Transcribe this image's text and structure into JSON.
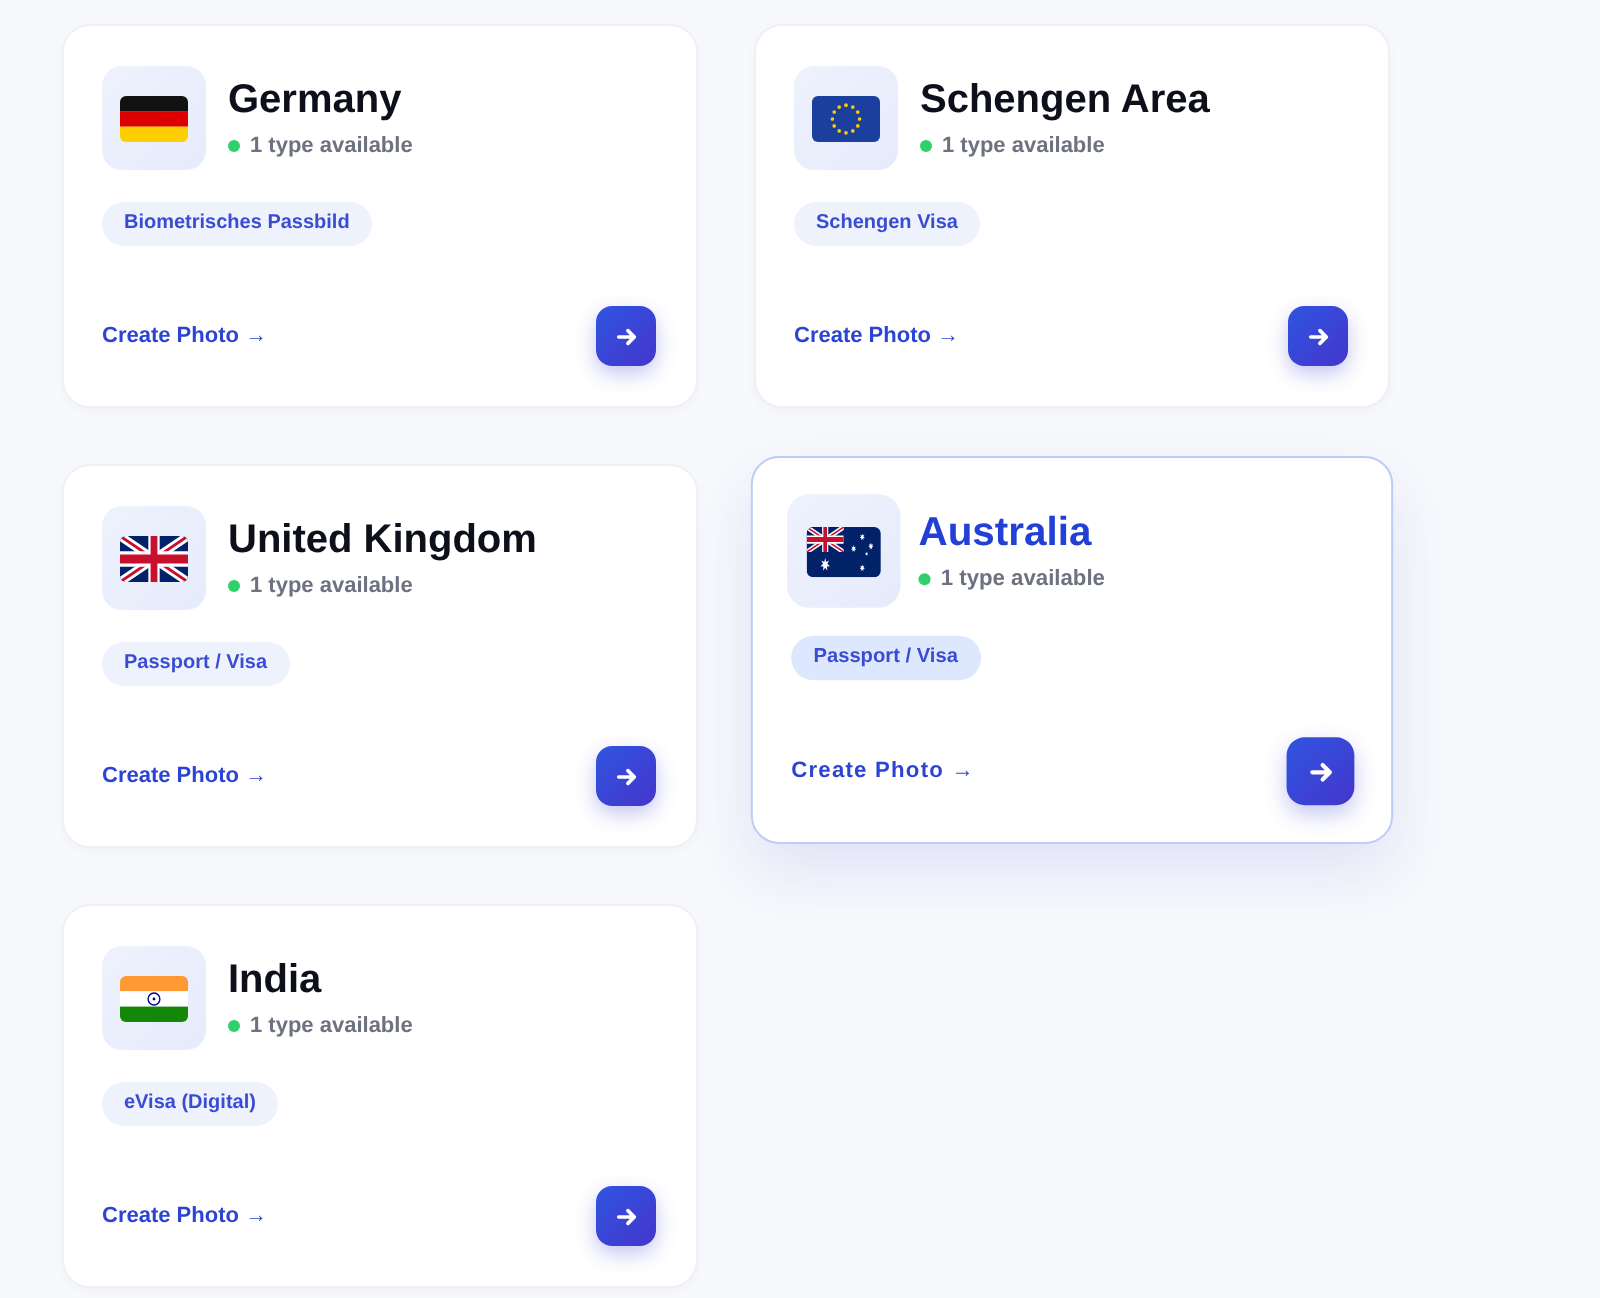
{
  "cards": [
    {
      "title": "Germany",
      "flag": {
        "kind": "germany"
      },
      "availability": "1 type available",
      "tags": [
        "Biometrisches Passbild"
      ],
      "link": "Create Photo →",
      "hovered": false
    },
    {
      "title": "Schengen Area",
      "flag": {
        "kind": "eu"
      },
      "availability": "1 type available",
      "tags": [
        "Schengen Visa"
      ],
      "link": "Create Photo →",
      "hovered": false
    },
    {
      "title": "United Kingdom",
      "flag": {
        "kind": "uk"
      },
      "availability": "1 type available",
      "tags": [
        "Passport / Visa"
      ],
      "link": "Create Photo →",
      "hovered": false
    },
    {
      "title": "Australia",
      "flag": {
        "kind": "australia"
      },
      "availability": "1 type available",
      "tags": [
        "Passport / Visa"
      ],
      "link": "Create Photo →",
      "hovered": true
    },
    {
      "title": "India",
      "flag": {
        "kind": "india"
      },
      "availability": "1 type available",
      "tags": [
        "eVisa (Digital)"
      ],
      "link": "Create Photo →",
      "hovered": false
    }
  ]
}
